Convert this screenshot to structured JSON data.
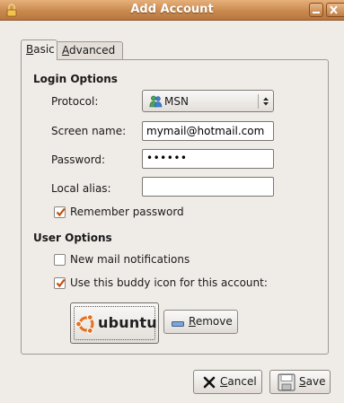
{
  "window": {
    "title": "Add Account"
  },
  "tabs": [
    {
      "mnemonic": "B",
      "rest": "asic"
    },
    {
      "mnemonic": "A",
      "rest": "dvanced"
    }
  ],
  "login_options": {
    "title": "Login Options",
    "protocol_label": "Protocol:",
    "protocol_value": "MSN",
    "screen_name_label": "Screen name:",
    "screen_name_value": "mymail@hotmail.com",
    "password_label": "Password:",
    "password_value": "••••••",
    "local_alias_label": "Local alias:",
    "local_alias_value": "",
    "remember_password_label": "Remember password",
    "remember_password_checked": true
  },
  "user_options": {
    "title": "User Options",
    "new_mail_label": "New mail notifications",
    "new_mail_checked": false,
    "buddy_icon_label": "Use this buddy icon for this account:",
    "buddy_icon_checked": true,
    "buddy_icon_text": "ubuntu",
    "remove_mnemonic": "R",
    "remove_rest": "emove"
  },
  "buttons": {
    "cancel_mnemonic": "C",
    "cancel_rest": "ancel",
    "save_mnemonic": "S",
    "save_rest": "ave"
  },
  "colors": {
    "titlebar": "#c98a4f",
    "check_mark": "#c14f10",
    "window_bg": "#efebe7"
  }
}
